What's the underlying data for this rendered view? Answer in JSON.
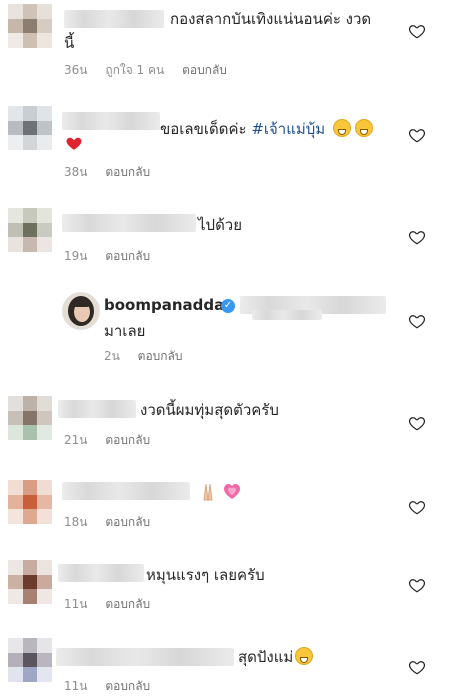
{
  "comments": [
    {
      "text": "กองสลากบันเทิงแน่นอนค่ะ งวด",
      "text_line2": "นี้",
      "time": "36น",
      "likes": "ถูกใจ 1 คน",
      "reply": "ตอบกลับ"
    },
    {
      "text": "ขอเลขเด็ดค่ะ ",
      "hashtag": "#เจ้าแม่บุ้ม",
      "emoji": [
        "grinning-face",
        "grinning-face",
        "red-heart"
      ],
      "time": "38น",
      "reply": "ตอบกลับ"
    },
    {
      "text": "ไปด้วย",
      "time": "19น",
      "reply": "ตอบกลับ"
    },
    {
      "username": "boompanadda",
      "verified_icon": "verified-badge-icon",
      "text": "มาเลย",
      "time": "2น",
      "reply": "ตอบกลับ"
    },
    {
      "text": "งวดนี้ผมทุ่มสุดตัวครับ",
      "time": "21น",
      "reply": "ตอบกลับ"
    },
    {
      "emoji": [
        "folded-hands",
        "growing-heart"
      ],
      "time": "18น",
      "reply": "ตอบกลับ"
    },
    {
      "text": "หมุนแรงๆ เลยครับ",
      "time": "11น",
      "reply": "ตอบกลับ"
    },
    {
      "text": "สุดปังแม่",
      "emoji": [
        "grinning-face"
      ],
      "time": "11น",
      "reply": "ตอบกลับ"
    }
  ],
  "colors": {
    "text": "#262626",
    "meta": "#8e8e8e",
    "hashtag": "#1f4f8f",
    "verified": "#3897f0"
  }
}
